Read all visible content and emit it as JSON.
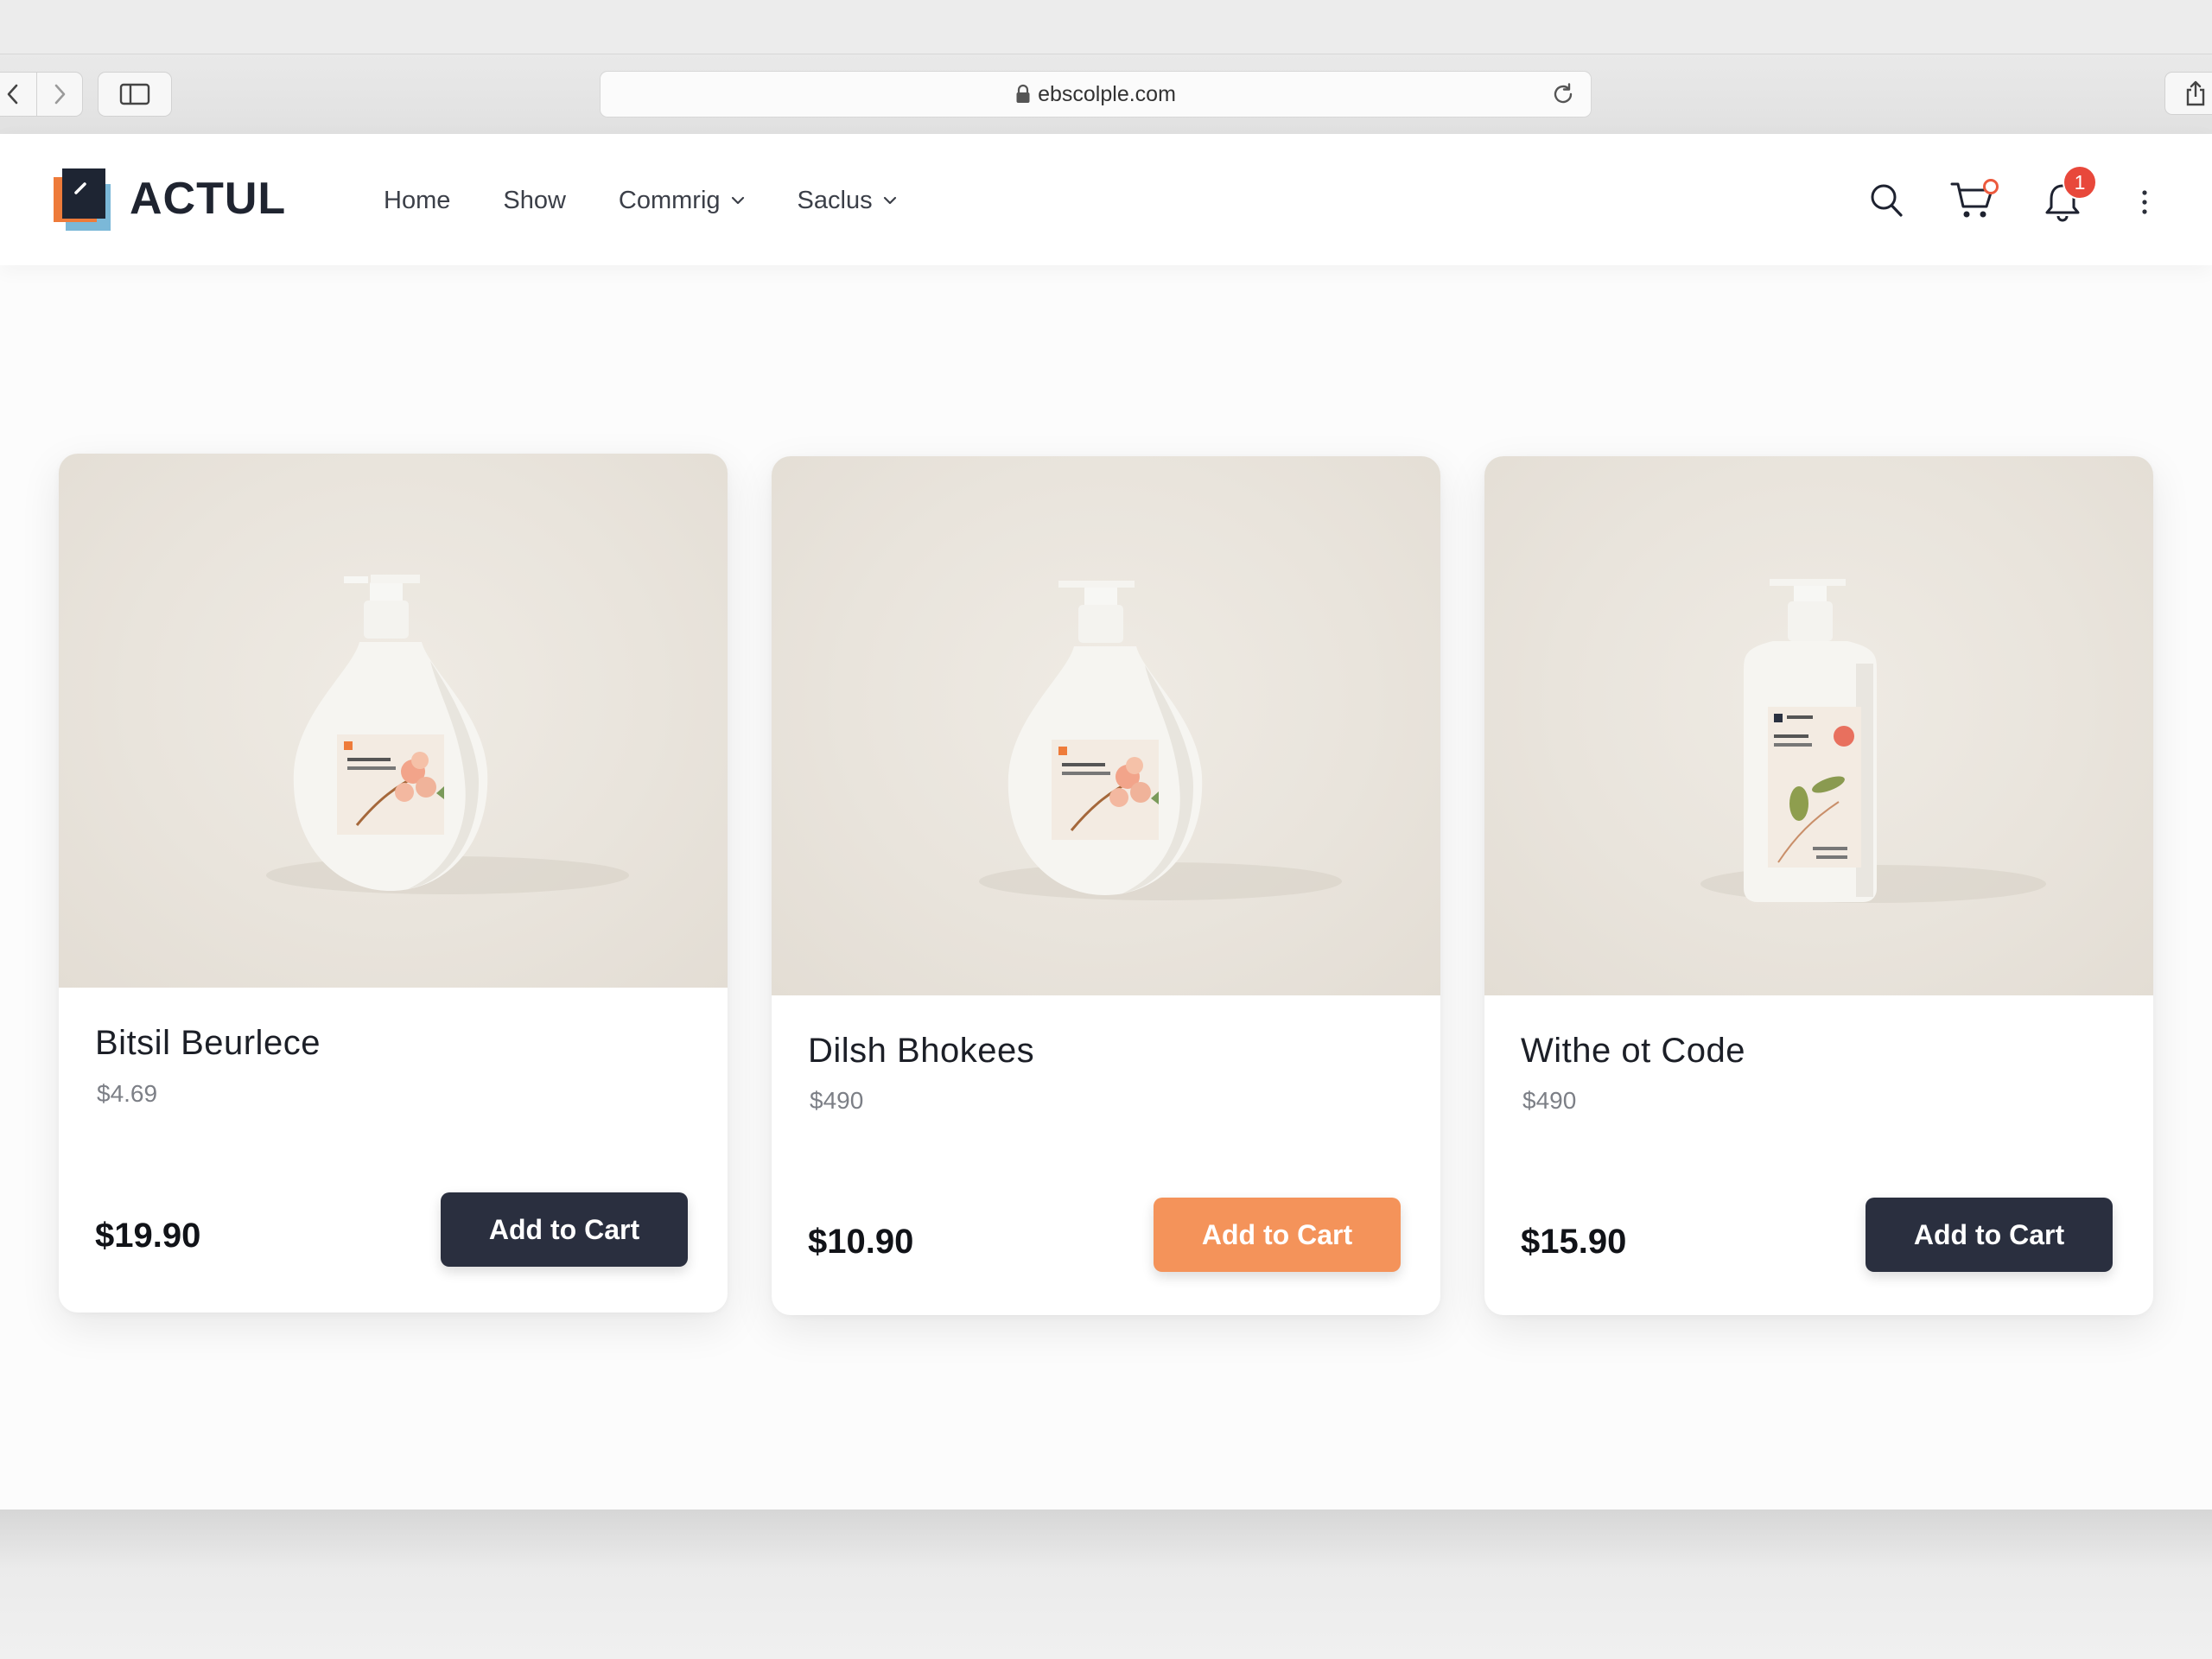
{
  "browser": {
    "address": "ebscolple.com"
  },
  "site": {
    "brand": "ACTUL",
    "nav": [
      {
        "label": "Home"
      },
      {
        "label": "Show"
      },
      {
        "label": "Commrig"
      },
      {
        "label": "Saclus"
      }
    ],
    "notification_count": "1"
  },
  "products": [
    {
      "title": "Bitsil Beurlece",
      "sub_price": "$4.69",
      "price": "$19.90",
      "button": "Add to Cart",
      "button_color": "#2a2f3f"
    },
    {
      "title": "Dilsh Bhokees",
      "sub_price": "$490",
      "price": "$10.90",
      "button": "Add to Cart",
      "button_color": "#f4935a"
    },
    {
      "title": "Withe ot Code",
      "sub_price": "$490",
      "price": "$15.90",
      "button": "Add to Cart",
      "button_color": "#2a2f3f"
    }
  ],
  "colors": {
    "accent_dark": "#2a2f3f",
    "accent_orange": "#f4935a",
    "badge_red": "#e8483b"
  }
}
